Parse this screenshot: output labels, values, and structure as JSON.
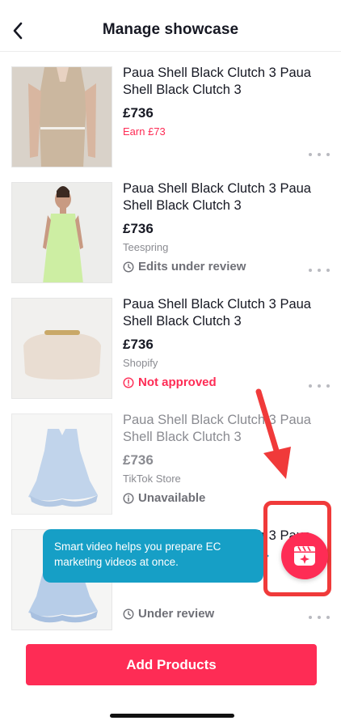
{
  "header": {
    "title": "Manage showcase",
    "back_icon": "chevron-left-icon"
  },
  "products": [
    {
      "name": "Paua Shell Black Clutch 3 Paua Shell Black Clutch 3",
      "price": "£736",
      "sub": "Earn £73",
      "sub_type": "earn",
      "status": "",
      "image": "beige-dress"
    },
    {
      "name": "Paua Shell Black Clutch 3 Paua Shell Black Clutch 3",
      "price": "£736",
      "sub": "Teespring",
      "sub_type": "source",
      "status": "Edits under review",
      "status_icon": "clock-icon",
      "image": "green-dress"
    },
    {
      "name": "Paua Shell Black Clutch 3 Paua Shell Black Clutch 3",
      "price": "£736",
      "sub": "Shopify",
      "sub_type": "source",
      "status": "Not approved",
      "status_icon": "alert-circle-icon",
      "image": "cream-clutch"
    },
    {
      "name": "Paua Shell Black Clutch 3 Paua Shell Black Clutch 3",
      "price": "£736",
      "sub": "TikTok Store",
      "sub_type": "source",
      "status": "Unavailable",
      "status_icon": "info-icon",
      "image": "blue-dress"
    },
    {
      "name": "Paua Shell Black Clutch 3 Paua Shell Black Clutch 3",
      "price": "",
      "sub": "",
      "status": "Under review",
      "status_icon": "clock-icon",
      "image": "blue-dress"
    }
  ],
  "tooltip": {
    "text": "Smart video helps you prepare EC marketing videos at once."
  },
  "add_button": {
    "label": "Add Products"
  },
  "colors": {
    "brand": "#fe2c55",
    "tooltip": "#169fc6",
    "annotation": "#f03a3a"
  }
}
